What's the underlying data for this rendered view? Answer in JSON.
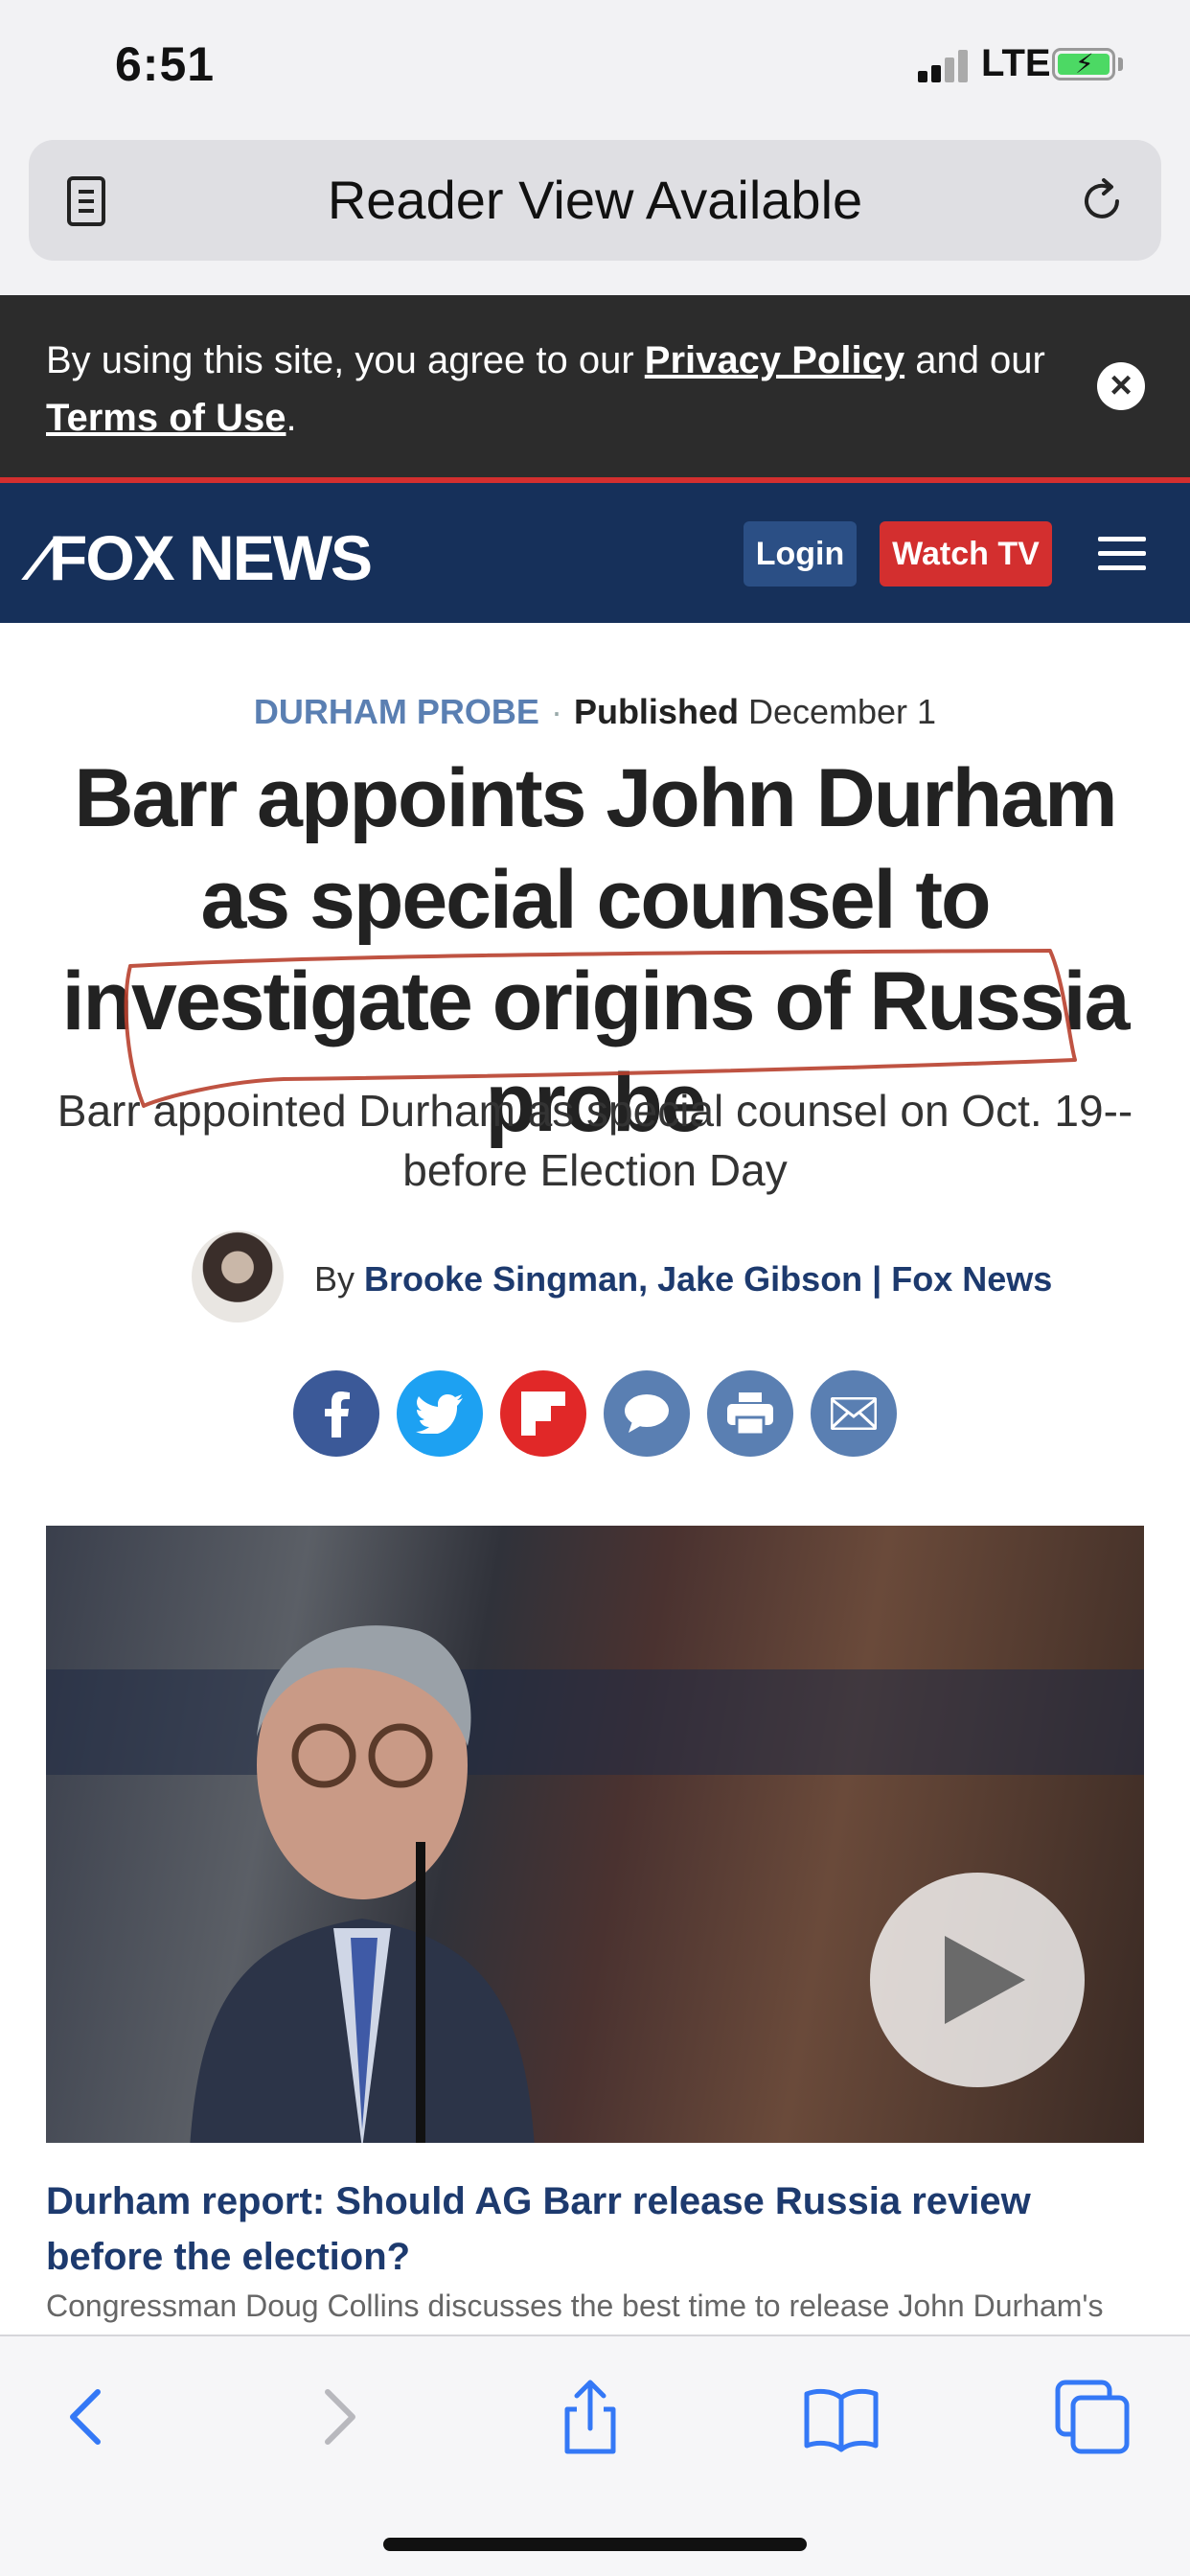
{
  "status_bar": {
    "time": "6:51",
    "network": "LTE"
  },
  "url_bar": {
    "text": "Reader View Available"
  },
  "cookie_banner": {
    "text_before": "By using this site, you agree to our ",
    "privacy_link": "Privacy Policy",
    "text_middle": " and our ",
    "terms_link": "Terms of Use",
    "text_after": "."
  },
  "header": {
    "logo_text": "FOX NEWS",
    "login_label": "Login",
    "watch_label": "Watch TV"
  },
  "article": {
    "category": "DURHAM PROBE",
    "separator": "·",
    "published_label": "Published",
    "published_date": "December 1",
    "headline": "Barr appoints John Durham as special counsel to investigate origins of Russia probe",
    "subhead": "Barr appointed Durham as special counsel on Oct. 19--before Election Day",
    "byline_prefix": "By",
    "authors": "Brooke Singman, Jake Gibson | Fox News",
    "video_caption": "Durham report: Should AG Barr release Russia review before the election?",
    "video_desc": "Congressman Doug Collins discusses the best time to release John Durham's"
  },
  "share_buttons": [
    {
      "name": "facebook-icon",
      "color": "#3b5998"
    },
    {
      "name": "twitter-icon",
      "color": "#1da1f2"
    },
    {
      "name": "flipboard-icon",
      "color": "#e12828"
    },
    {
      "name": "comment-icon",
      "color": "#5a7fb2"
    },
    {
      "name": "print-icon",
      "color": "#5a7fb2"
    },
    {
      "name": "email-icon",
      "color": "#5a7fb2"
    }
  ],
  "colors": {
    "fox_navy": "#16305a",
    "accent_red": "#d32f2f",
    "link_blue": "#1d3a6e",
    "ios_blue": "#3478f6"
  }
}
